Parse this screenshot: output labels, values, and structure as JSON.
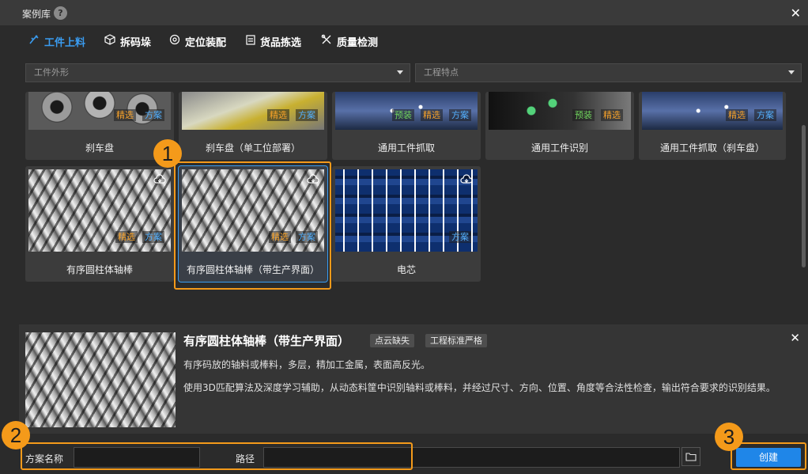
{
  "window": {
    "title": "案例库",
    "help_symbol": "?",
    "close_symbol": "✕"
  },
  "tabs": [
    {
      "label": "工件上料",
      "icon": "workpiece-loading-icon",
      "active": true
    },
    {
      "label": "拆码垛",
      "icon": "box-icon",
      "active": false
    },
    {
      "label": "定位装配",
      "icon": "gear-icon",
      "active": false
    },
    {
      "label": "货品拣选",
      "icon": "clipboard-icon",
      "active": false
    },
    {
      "label": "质量检测",
      "icon": "tools-icon",
      "active": false
    }
  ],
  "filters": {
    "shape_placeholder": "工件外形",
    "feature_placeholder": "工程特点"
  },
  "badges": {
    "featured": "精选",
    "solution": "方案",
    "preinstalled": "预装"
  },
  "cards_row1": [
    {
      "label": "刹车盘"
    },
    {
      "label": "刹车盘（单工位部署）"
    },
    {
      "label": "通用工件抓取"
    },
    {
      "label": "通用工件识别"
    },
    {
      "label": "通用工件抓取（刹车盘）"
    }
  ],
  "cards_row2": [
    {
      "label": "有序圆柱体轴棒"
    },
    {
      "label": "有序圆柱体轴棒（带生产界面）"
    },
    {
      "label": "电芯"
    }
  ],
  "detail": {
    "title": "有序圆柱体轴棒（带生产界面）",
    "tags": [
      "点云缺失",
      "工程标准严格"
    ],
    "description_short": "有序码放的轴料或棒料，多层，精加工金属，表面高反光。",
    "description_long": "使用3D匹配算法及深度学习辅助，从动态料筐中识别轴料或棒料，并经过尺寸、方向、位置、角度等合法性检查，输出符合要求的识别结果。",
    "close_symbol": "✕"
  },
  "form": {
    "name_label": "方案名称",
    "name_value": "",
    "path_label": "路径",
    "path_value": "",
    "create_label": "创建"
  },
  "callouts": [
    "1",
    "2",
    "3"
  ],
  "colors": {
    "accent": "#3a9cf0",
    "callout": "#f49a1a",
    "create_button": "#1f86e8"
  }
}
